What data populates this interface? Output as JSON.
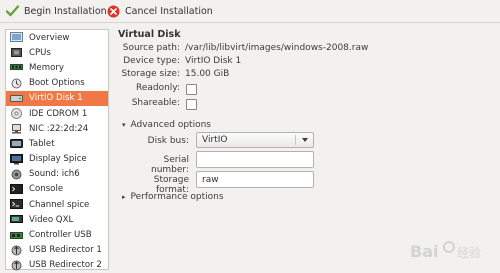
{
  "toolbar": {
    "begin_label": "Begin Installation",
    "cancel_label": "Cancel Installation"
  },
  "sidebar": {
    "items": [
      {
        "label": "Overview",
        "icon": "overview-icon"
      },
      {
        "label": "CPUs",
        "icon": "cpu-icon"
      },
      {
        "label": "Memory",
        "icon": "memory-icon"
      },
      {
        "label": "Boot Options",
        "icon": "boot-options-icon"
      },
      {
        "label": "VirtIO Disk 1",
        "icon": "disk-icon",
        "selected": true
      },
      {
        "label": "IDE CDROM 1",
        "icon": "cdrom-icon"
      },
      {
        "label": "NIC :22:2d:24",
        "icon": "network-icon"
      },
      {
        "label": "Tablet",
        "icon": "tablet-icon"
      },
      {
        "label": "Display Spice",
        "icon": "display-icon"
      },
      {
        "label": "Sound: ich6",
        "icon": "sound-icon"
      },
      {
        "label": "Console",
        "icon": "console-icon"
      },
      {
        "label": "Channel spice",
        "icon": "channel-icon"
      },
      {
        "label": "Video QXL",
        "icon": "video-icon"
      },
      {
        "label": "Controller USB",
        "icon": "controller-icon"
      },
      {
        "label": "USB Redirector 1",
        "icon": "usb-redirector-icon"
      },
      {
        "label": "USB Redirector 2",
        "icon": "usb-redirector-icon"
      }
    ]
  },
  "main": {
    "title": "Virtual Disk",
    "source_path_label": "Source path:",
    "source_path": "/var/lib/libvirt/images/windows-2008.raw",
    "device_type_label": "Device type:",
    "device_type": "VirtIO Disk 1",
    "storage_size_label": "Storage size:",
    "storage_size": "15.00 GiB",
    "readonly_label": "Readonly:",
    "shareable_label": "Shareable:",
    "advanced_label": "Advanced options",
    "disk_bus_label": "Disk bus:",
    "disk_bus_value": "VirtIO",
    "serial_label": "Serial number:",
    "serial_value": "",
    "storage_format_label": "Storage format:",
    "storage_format_value": "raw",
    "performance_label": "Performance options"
  },
  "watermark": {
    "text": "Baidu 经验"
  },
  "colors": {
    "selection": "#f07746",
    "background": "#f2f1f0"
  }
}
